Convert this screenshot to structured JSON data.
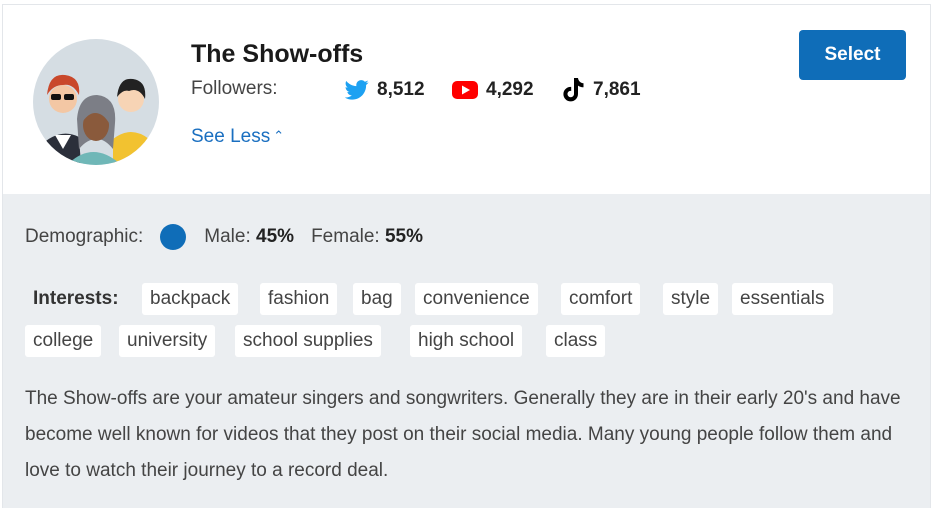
{
  "persona": {
    "title": "The Show-offs",
    "avatar": "group-avatar-illustration",
    "followers_label": "Followers:",
    "stats": [
      {
        "platform": "twitter",
        "icon": "twitter-icon",
        "color": "#1da1f2",
        "count": "8,512"
      },
      {
        "platform": "youtube",
        "icon": "youtube-icon",
        "color": "#ff0000",
        "count": "4,292"
      },
      {
        "platform": "tiktok",
        "icon": "tiktok-icon",
        "color": "#000000",
        "count": "7,861"
      }
    ],
    "see_less": "See Less",
    "select_label": "Select",
    "accent_color": "#0f6db8"
  },
  "demographic": {
    "label": "Demographic:",
    "male_label": "Male:",
    "male_value": "45%",
    "female_label": "Female:",
    "female_value": "55%"
  },
  "interests": {
    "label": "Interests:",
    "tags": [
      "backpack",
      "fashion",
      "bag",
      "convenience",
      "comfort",
      "style",
      "essentials",
      "college",
      "university",
      "school supplies",
      "high school",
      "class"
    ]
  },
  "description": "The Show-offs are your amateur singers and songwriters. Generally they are in their early 20's and have become well known for videos that they post on their social media. Many young people follow them and love to watch their journey to a record deal."
}
